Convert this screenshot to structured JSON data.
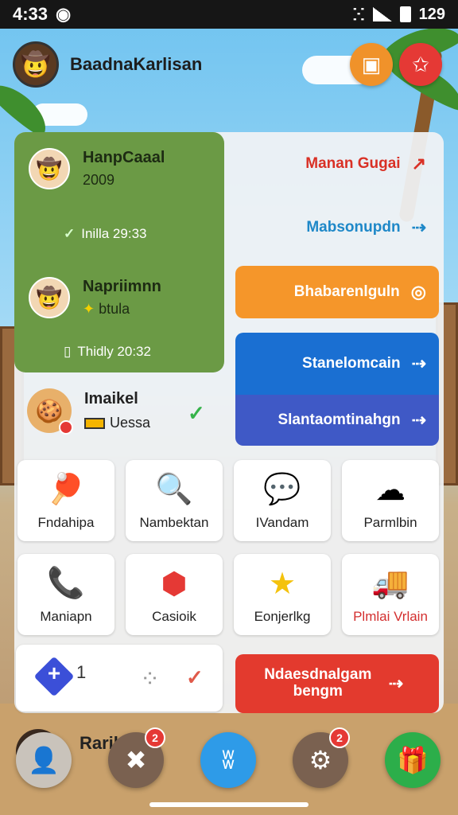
{
  "status_bar": {
    "time": "4:33",
    "right_text": "129"
  },
  "header": {
    "app_title": "BaadnaKarlisan"
  },
  "contacts": [
    {
      "name": "HanpCaaal",
      "sub": "2009",
      "meta": "Inilla 29:33"
    },
    {
      "name": "Napriimnn",
      "sub": "btula",
      "meta": "Thidly 20:32"
    }
  ],
  "friend": {
    "name": "Imaikel",
    "tag": "Uessa"
  },
  "actions": {
    "red_text": "Manan Gugai",
    "blue_text": "Mabsonupdn",
    "orange": "Bhabarenlguln",
    "blue": "Stanelomcain",
    "indigo": "Slantaomtinahgn",
    "red_button": "Ndaesdnalgam bengm"
  },
  "tiles": [
    {
      "label": "Fndahipa",
      "icon": "paddle-icon"
    },
    {
      "label": "Nambektan",
      "icon": "magnifier-icon"
    },
    {
      "label": "IVandam",
      "icon": "speech-bubble-icon"
    },
    {
      "label": "Parmlbin",
      "icon": "cloud-outline-icon"
    },
    {
      "label": "Maniapn",
      "icon": "phone-icon"
    },
    {
      "label": "Casioik",
      "icon": "dollar-shield-icon"
    },
    {
      "label": "Eonjerlkg",
      "icon": "star-icon"
    },
    {
      "label": "Plmlai Vrlain",
      "icon": "truck-icon"
    }
  ],
  "bottom_card": {
    "count": "1"
  },
  "peek": {
    "name": "Raribs"
  },
  "nav": {
    "badge_2": "2",
    "badge_4": "2"
  }
}
